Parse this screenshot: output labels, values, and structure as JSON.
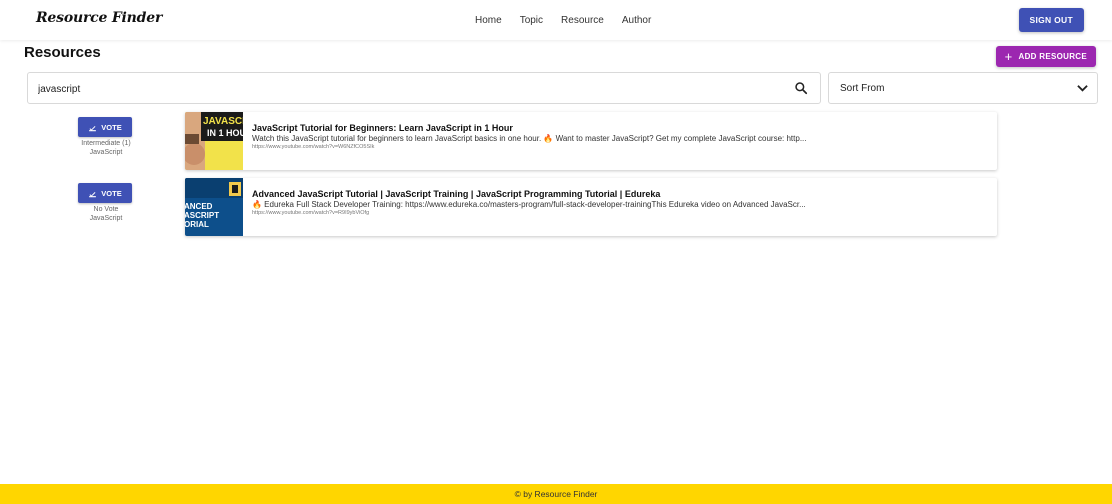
{
  "app": {
    "brand": "Resource Finder"
  },
  "nav": {
    "links": [
      "Home",
      "Topic",
      "Resource",
      "Author"
    ],
    "signout_label": "SIGN OUT"
  },
  "page": {
    "title": "Resources",
    "add_label": "ADD RESOURCE"
  },
  "search": {
    "value": "javascript",
    "placeholder": ""
  },
  "sort": {
    "label": "Sort From"
  },
  "resources": [
    {
      "vote_label": "VOTE",
      "level": "Intermediate (1)",
      "topic": "JavaScript",
      "thumb_lines": [
        "JAVASCR",
        "IN 1 HOU"
      ],
      "title": "JavaScript Tutorial for Beginners: Learn JavaScript in 1 Hour",
      "description": "Watch this JavaScript tutorial for beginners to learn JavaScript basics in one hour. 🔥 Want to master JavaScript? Get my complete JavaScript course: http...",
      "url": "https://www.youtube.com/watch?v=W6NZfCO5SIk"
    },
    {
      "vote_label": "VOTE",
      "level": "No Vote",
      "topic": "JavaScript",
      "thumb_lines": [
        "ANCED",
        "ASCRIPT",
        "ORIAL"
      ],
      "title": "Advanced JavaScript Tutorial | JavaScript Training | JavaScript Programming Tutorial | Edureka",
      "description": "🔥 Edureka Full Stack Developer Training: https://www.edureka.co/masters-program/full-stack-developer-trainingThis Edureka video on Advanced JavaScr...",
      "url": "https://www.youtube.com/watch?v=R9I9ybViOfg"
    }
  ],
  "footer": {
    "text": "© by Resource Finder"
  },
  "colors": {
    "primary": "#3f51b5",
    "secondary": "#9c27b0",
    "footer": "#ffd600"
  }
}
